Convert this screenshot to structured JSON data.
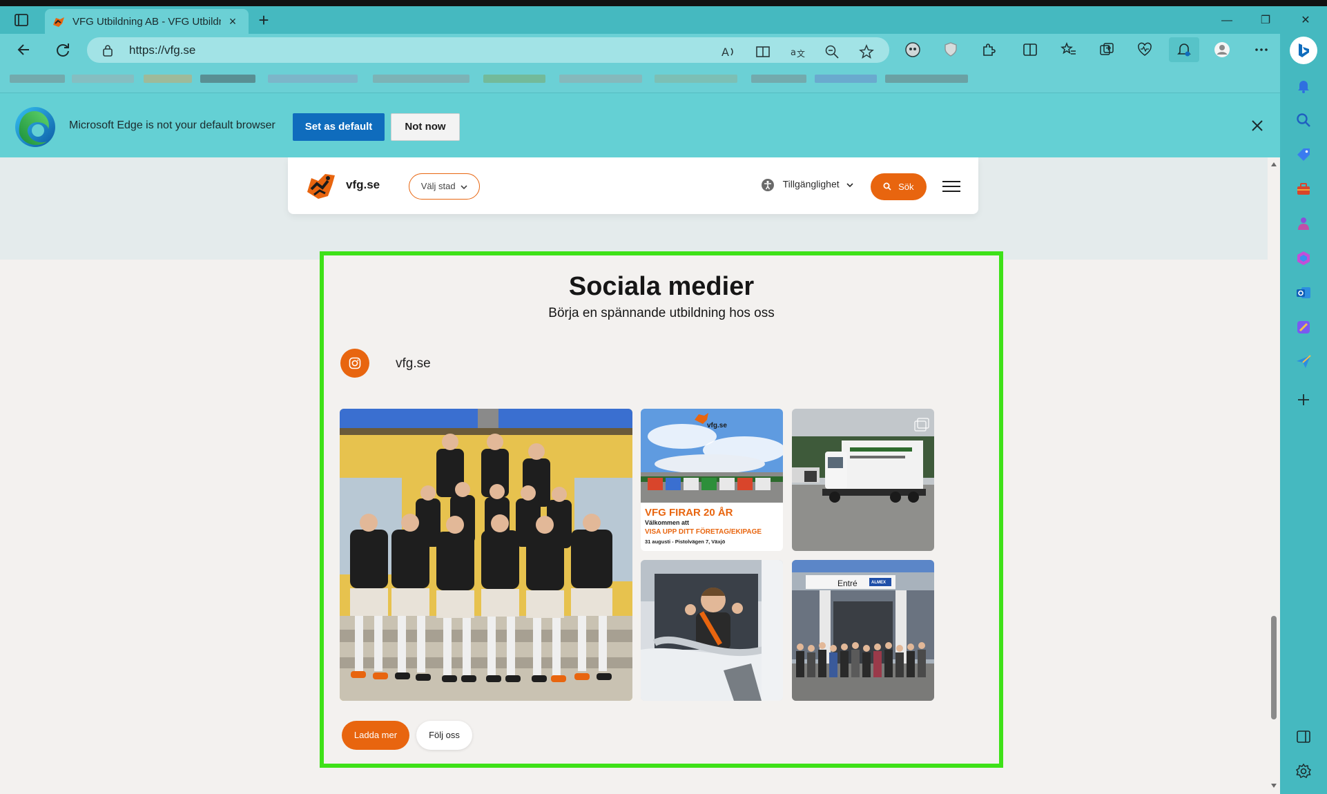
{
  "browser": {
    "tab_title": "VFG Utbildning AB - VFG Utbildning",
    "url": "https://vfg.se",
    "new_tab_symbol": "+",
    "tab_close_symbol": "×",
    "window_minimize": "—",
    "window_restore": "❐",
    "window_close": "✕"
  },
  "infobar": {
    "message": "Microsoft Edge is not your default browser",
    "set_default_label": "Set as default",
    "not_now_label": "Not now"
  },
  "site": {
    "name": "vfg.se",
    "city_select": "Välj stad",
    "accessibility_label": "Tillgänglighet",
    "search_label": "Sök"
  },
  "social": {
    "title": "Sociala medier",
    "subtitle": "Börja en spännande utbildning hos oss",
    "handle": "vfg.se",
    "load_more_label": "Ladda mer",
    "follow_label": "Följ oss",
    "poster": {
      "brand": "vfg.se",
      "headline": "VFG FIRAR 20 ÅR",
      "line1": "Välkommen att",
      "line2": "VISA UPP DITT FÖRETAG/EKIPAGE",
      "line3": "31 augusti - Pistolvägen 7, Växjö"
    },
    "entrance_sign": "Entré",
    "entrance_brand": "ALMEX"
  },
  "colors": {
    "accent": "#e8650f",
    "browser_teal": "#6bd0d5",
    "highlight_border": "#3ee118",
    "edge_blue": "#0f6cbd"
  }
}
